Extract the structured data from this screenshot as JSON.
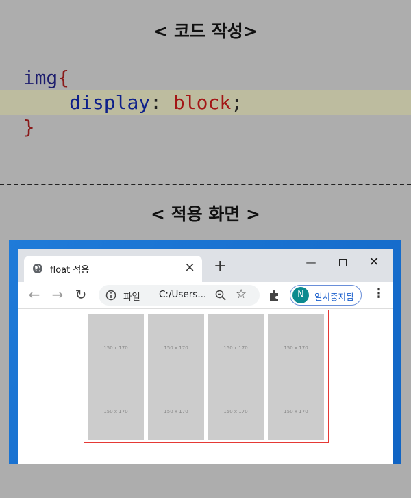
{
  "sections": {
    "code_title": "< 코드 작성>",
    "result_title": "< 적용 화면 >"
  },
  "code": {
    "selector": "img",
    "open_brace": "{",
    "property": "display",
    "colon": ":",
    "value": "block",
    "semicolon": ";",
    "close_brace": "}"
  },
  "browser": {
    "tab_title": "float 적용",
    "tab_close": "×",
    "new_tab": "+",
    "window_controls": {
      "minimize": "—",
      "close": "✕"
    },
    "nav": {
      "back": "←",
      "forward": "→",
      "reload": "↻"
    },
    "address": {
      "label": "파일",
      "url": "C:/Users..."
    },
    "star": "☆",
    "profile": {
      "initial": "N",
      "label": "일시중지됨"
    },
    "menu": "⋮"
  },
  "content": {
    "images": [
      {
        "top_label": "150 x 170",
        "bottom_label": "150 x 170"
      },
      {
        "top_label": "150 x 170",
        "bottom_label": "150 x 170"
      },
      {
        "top_label": "150 x 170",
        "bottom_label": "150 x 170"
      },
      {
        "top_label": "150 x 170",
        "bottom_label": "150 x 170"
      }
    ]
  },
  "colors": {
    "container_border": "#e53935",
    "placeholder_fill": "#cccccc",
    "highlight_line": "#bdbc9f",
    "avatar": "#0b8a8f"
  }
}
